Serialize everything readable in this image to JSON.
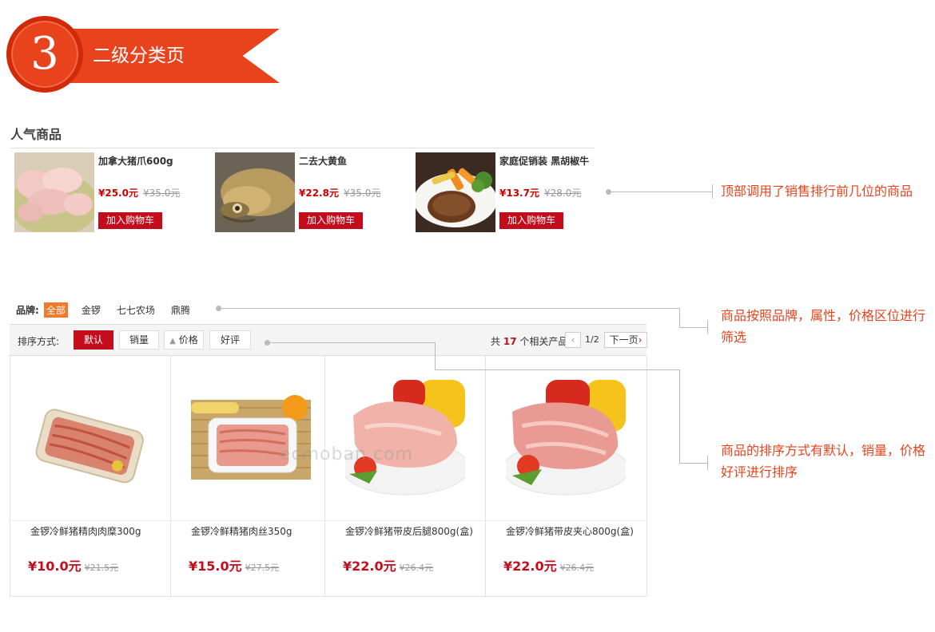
{
  "banner": {
    "step_number": "3",
    "title": "二级分类页"
  },
  "popular": {
    "heading": "人气商品",
    "products": [
      {
        "name": "加拿大猪爪600g",
        "price": "¥25.0元",
        "old_price": "¥35.0元",
        "button": "加入购物车"
      },
      {
        "name": "二去大黄鱼",
        "price": "¥22.8元",
        "old_price": "¥35.0元",
        "button": "加入购物车"
      },
      {
        "name": "家庭促销装 黑胡椒牛",
        "price": "¥13.7元",
        "old_price": "¥28.0元",
        "button": "加入购物车"
      }
    ]
  },
  "brand_filter": {
    "label": "品牌:",
    "options": [
      "全部",
      "金锣",
      "七七农场",
      "鼎腾"
    ],
    "selected": "全部"
  },
  "sort_bar": {
    "label": "排序方式:",
    "options": [
      "默认",
      "销量",
      "价格",
      "好评"
    ],
    "selected": "默认",
    "total_prefix": "共",
    "total_count": "17",
    "total_suffix": "个相关产品",
    "page_indicator": "1/2",
    "next_label": "下一页"
  },
  "products": [
    {
      "name": "金锣冷鲜猪精肉肉糜300g",
      "price": "¥10.0元",
      "old_price": "¥21.5元"
    },
    {
      "name": "金锣冷鲜精猪肉丝350g",
      "price": "¥15.0元",
      "old_price": "¥27.5元"
    },
    {
      "name": "金锣冷鲜猪带皮后腿800g(盒)",
      "price": "¥22.0元",
      "old_price": "¥26.4元"
    },
    {
      "name": "金锣冷鲜猪带皮夹心800g(盒)",
      "price": "¥22.0元",
      "old_price": "¥26.4元"
    }
  ],
  "watermark": "ecmoban.com",
  "annotations": {
    "popular": "顶部调用了销售排行前几位的商品",
    "filter": "商品按照品牌，属性，价格区位进行筛选",
    "sort": "商品的排序方式有默认，销量，价格好评进行排序"
  },
  "colors": {
    "accent": "#e8431c",
    "button_red": "#c40d1c",
    "price_red": "#c40d1c"
  }
}
